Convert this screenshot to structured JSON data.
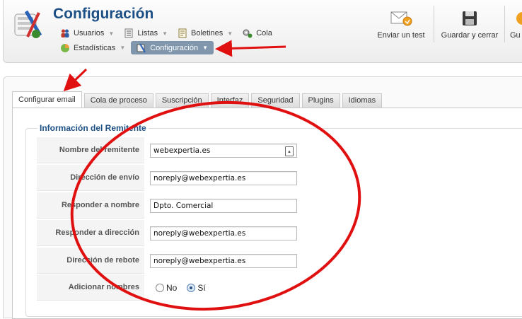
{
  "header": {
    "title": "Configuración",
    "menu_row_1": [
      {
        "label": "Usuarios",
        "icon": "users-icon",
        "has_caret": true
      },
      {
        "label": "Listas",
        "icon": "list-icon",
        "has_caret": true
      },
      {
        "label": "Boletines",
        "icon": "newsletter-icon",
        "has_caret": true
      },
      {
        "label": "Cola",
        "icon": "queue-icon",
        "has_caret": false
      }
    ],
    "menu_row_2": [
      {
        "label": "Estadísticas",
        "icon": "statistics-icon",
        "has_caret": true
      },
      {
        "label": "Configuración",
        "icon": "configuration-icon",
        "has_caret": true,
        "active": true
      }
    ]
  },
  "toolbar": {
    "send_test_label": "Enviar un test",
    "save_close_label": "Guardar y cerrar",
    "save_partial_label": "Gu"
  },
  "tabs": [
    {
      "label": "Configurar email",
      "active": true
    },
    {
      "label": "Cola de proceso"
    },
    {
      "label": "Suscripción"
    },
    {
      "label": "Interfaz"
    },
    {
      "label": "Seguridad"
    },
    {
      "label": "Plugins"
    },
    {
      "label": "Idiomas"
    }
  ],
  "sender_section": {
    "legend": "Información del Remitente",
    "fields": {
      "sender_name": {
        "label": "Nombre del remitente",
        "value": "webexpertia.es"
      },
      "send_address": {
        "label": "Dirección de envío",
        "value": "noreply@webexpertia.es"
      },
      "reply_name": {
        "label": "Responder a nombre",
        "value": "Dpto. Comercial"
      },
      "reply_address": {
        "label": "Responder a dirección",
        "value": "noreply@webexpertia.es"
      },
      "bounce_address": {
        "label": "Dirección de rebote",
        "value": "noreply@webexpertia.es"
      }
    },
    "add_names": {
      "label": "Adicionar nombres",
      "option_no": "No",
      "option_yes": "Sí",
      "selected": "Sí"
    }
  },
  "colors": {
    "title": "#1c4f84",
    "active_menu": "#7f96ac",
    "annotation": "#e01010"
  }
}
